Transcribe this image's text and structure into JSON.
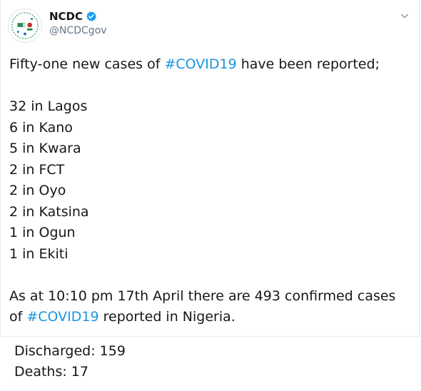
{
  "tweet": {
    "author": {
      "display_name": "NCDC",
      "handle": "@NCDCgov",
      "verified": true,
      "avatar_icon": "ncdc-logo-icon"
    },
    "menu_icon": "chevron-down-icon",
    "intro": {
      "before": "Fifty-one new cases of ",
      "hashtag": "#COVID19",
      "after": " have been reported;"
    },
    "cases": [
      "32 in Lagos",
      "6 in Kano",
      "5 in Kwara",
      "2 in FCT",
      "2 in Oyo",
      "2 in Katsina",
      "1 in Ogun",
      "1 in Ekiti"
    ],
    "summary": {
      "line1": "As at 10:10 pm 17th April there are 493 confirmed cases",
      "line2_before": "of ",
      "line2_hashtag": "#COVID19",
      "line2_after": " reported in Nigeria."
    }
  },
  "stats": {
    "discharged": "Discharged: 159",
    "deaths": "Deaths: 17"
  },
  "colors": {
    "hashtag": "#1b95e0",
    "verified": "#1da1f2",
    "handle": "#657786"
  }
}
